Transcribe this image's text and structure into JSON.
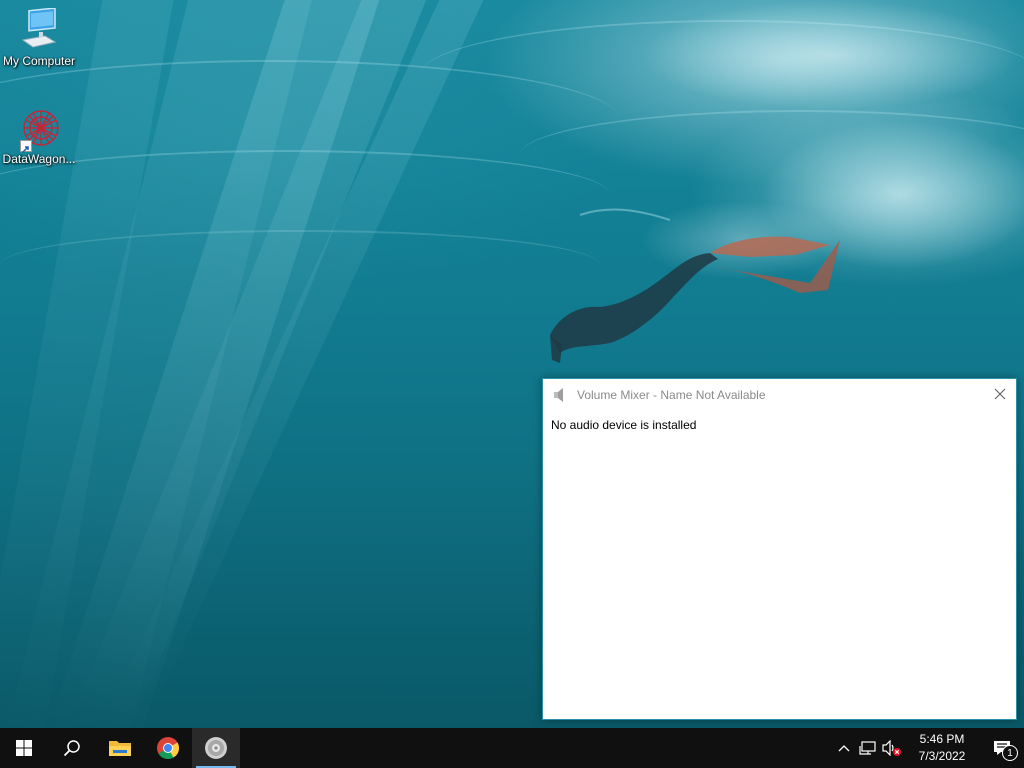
{
  "desktop": {
    "icons": [
      {
        "label": "My Computer",
        "icon": "monitor-icon"
      },
      {
        "label": "DataWagon...",
        "icon": "datawagon-logo-icon"
      }
    ]
  },
  "volume_mixer": {
    "title": "Volume Mixer - Name Not Available",
    "message": "No audio device is installed",
    "close_icon": "close-icon"
  },
  "taskbar": {
    "start_icon": "windows-start-icon",
    "search_icon": "search-icon",
    "pinned": [
      {
        "name": "File Explorer",
        "icon": "folder-icon"
      },
      {
        "name": "Google Chrome",
        "icon": "chrome-icon"
      },
      {
        "name": "Volume Mixer",
        "icon": "speaker-icon",
        "active": true
      }
    ],
    "tray": {
      "chevron_icon": "chevron-up-icon",
      "network_icon": "network-icon",
      "volume_icon": "volume-muted-icon",
      "time": "5:46 PM",
      "date": "7/3/2022",
      "notification_count": "1"
    }
  },
  "colors": {
    "taskbar": "#101010",
    "active_indicator": "#76b9ed",
    "window_border": "#2b8fa6"
  }
}
